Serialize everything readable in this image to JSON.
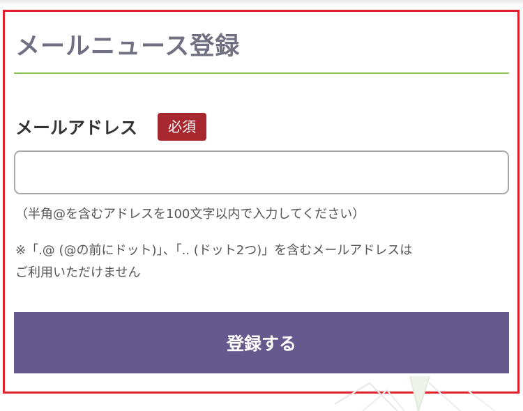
{
  "form": {
    "title": "メールニュース登録",
    "email_label": "メールアドレス",
    "required_badge": "必須",
    "email_value": "",
    "email_placeholder": "",
    "hint": "（半角@を含むアドレスを100文字以内で入力してください）",
    "note_line1": "※「.@ (@の前にドット)」、「.. (ドット2つ)」を含むメールアドレスは",
    "note_line2": "ご利用いただけません",
    "submit_label": "登録する"
  },
  "colors": {
    "title": "#707082",
    "rule": "#8cc54f",
    "badge": "#a8282f",
    "button": "#66598e",
    "frame": "#e0202a"
  }
}
